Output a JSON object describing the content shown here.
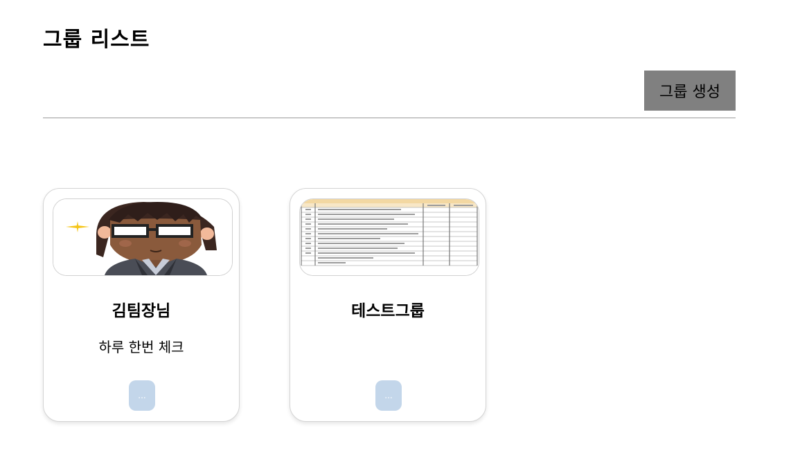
{
  "header": {
    "title": "그룹 리스트",
    "create_button_label": "그룹 생성"
  },
  "groups": [
    {
      "name": "김팀장님",
      "description": "하루 한번 체크",
      "thumbnail": "avatar-illustration",
      "more_label": "..."
    },
    {
      "name": "테스트그룹",
      "description": "",
      "thumbnail": "spreadsheet-document",
      "more_label": "..."
    }
  ],
  "colors": {
    "create_button_bg": "#808080",
    "more_button_bg": "#c3d6ea",
    "divider": "#9a9a9a"
  }
}
